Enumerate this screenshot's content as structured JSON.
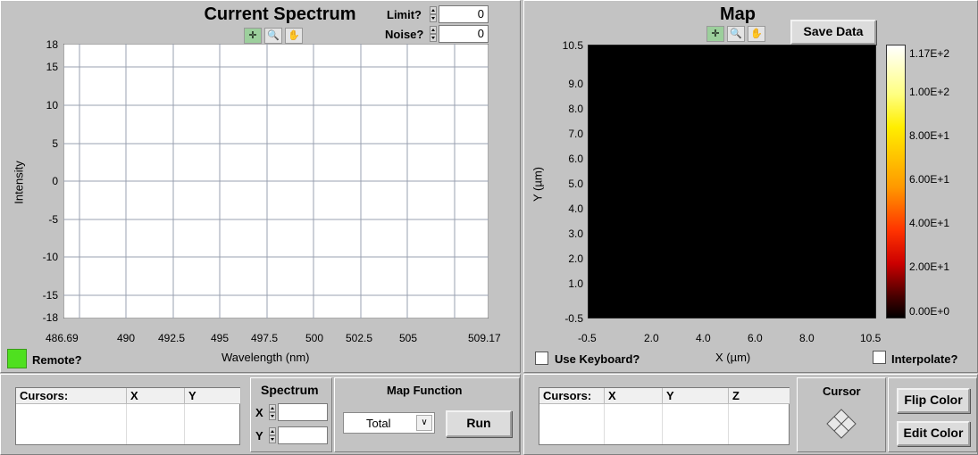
{
  "spectrum_graph": {
    "title": "Current Spectrum",
    "limit_label": "Limit?",
    "limit_value": "0",
    "noise_label": "Noise?",
    "noise_value": "0",
    "ylabel": "Intensity",
    "xlabel": "Wavelength (nm)",
    "y_ticks": [
      "18",
      "15",
      "10",
      "5",
      "0",
      "-5",
      "-10",
      "-15",
      "-18"
    ],
    "x_ticks": [
      "486.69",
      "490",
      "492.5",
      "495",
      "497.5",
      "500",
      "502.5",
      "505",
      "509.17"
    ],
    "remote_label": "Remote?",
    "remote_led_color": "#4fe01f"
  },
  "map_graph": {
    "title": "Map",
    "save_label": "Save Data",
    "ylabel": "Y (µm)",
    "xlabel": "X (µm)",
    "y_ticks": [
      "10.5",
      "9.0",
      "8.0",
      "7.0",
      "6.0",
      "5.0",
      "4.0",
      "3.0",
      "2.0",
      "1.0",
      "-0.5"
    ],
    "x_ticks": [
      "-0.5",
      "2.0",
      "4.0",
      "6.0",
      "8.0",
      "10.5"
    ],
    "colorbar_ticks": [
      "1.17E+2",
      "1.00E+2",
      "8.00E+1",
      "6.00E+1",
      "4.00E+1",
      "2.00E+1",
      "0.00E+0"
    ],
    "use_keyboard_label": "Use Keyboard?",
    "interpolate_label": "Interpolate?"
  },
  "bottom_left": {
    "cursors_table": {
      "headers": [
        "Cursors:",
        "X",
        "Y"
      ]
    },
    "spectrum_label": "Spectrum",
    "spectrum_x_label": "X",
    "spectrum_y_label": "Y",
    "spectrum_x_value": "",
    "spectrum_y_value": "",
    "map_function_label": "Map Function",
    "map_function_selected": "Total",
    "run_label": "Run"
  },
  "bottom_right": {
    "cursors_table": {
      "headers": [
        "Cursors:",
        "X",
        "Y",
        "Z"
      ]
    },
    "cursor_label": "Cursor",
    "flip_color_label": "Flip Color",
    "edit_color_label": "Edit Color"
  },
  "icons": [
    "crosshair-tool-icon",
    "zoom-tool-icon",
    "pan-hand-icon",
    "cursor-move-diamond-icon",
    "dropdown-arrow-icon"
  ]
}
